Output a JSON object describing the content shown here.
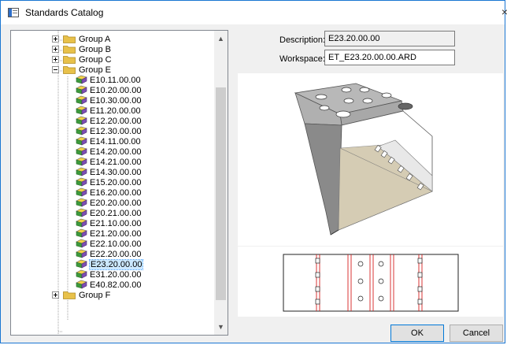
{
  "window": {
    "title": "Standards Catalog",
    "close_glyph": "×"
  },
  "tree": {
    "groups_top": [
      {
        "label": "Group A",
        "expanded": false
      },
      {
        "label": "Group B",
        "expanded": false
      },
      {
        "label": "Group C",
        "expanded": false
      },
      {
        "label": "Group E",
        "expanded": true
      }
    ],
    "items": [
      "E10.11.00.00",
      "E10.20.00.00",
      "E10.30.00.00",
      "E11.20.00.00",
      "E12.20.00.00",
      "E12.30.00.00",
      "E14.11.00.00",
      "E14.20.00.00",
      "E14.21.00.00",
      "E14.30.00.00",
      "E15.20.00.00",
      "E16.20.00.00",
      "E20.20.00.00",
      "E20.21.00.00",
      "E21.10.00.00",
      "E21.20.00.00",
      "E22.10.00.00",
      "E22.20.00.00",
      "E23.20.00.00",
      "E31.20.00.00",
      "E40.82.00.00"
    ],
    "selected": "E23.20.00.00",
    "group_bottom": {
      "label": "Group F",
      "expanded": false
    },
    "icons": {
      "folder": "folder-icon",
      "part": "part-icon"
    }
  },
  "details": {
    "description_label": "Description:",
    "description_value": "E23.20.00.00",
    "workspace_label": "Workspace:",
    "workspace_value": "ET_E23.20.00.00.ARD"
  },
  "buttons": {
    "ok": "OK",
    "cancel": "Cancel"
  },
  "colors": {
    "selection": "#cce8ff",
    "folder": "#e8c14a",
    "window_border": "#1a76d2",
    "profile_line": "#d62020"
  }
}
